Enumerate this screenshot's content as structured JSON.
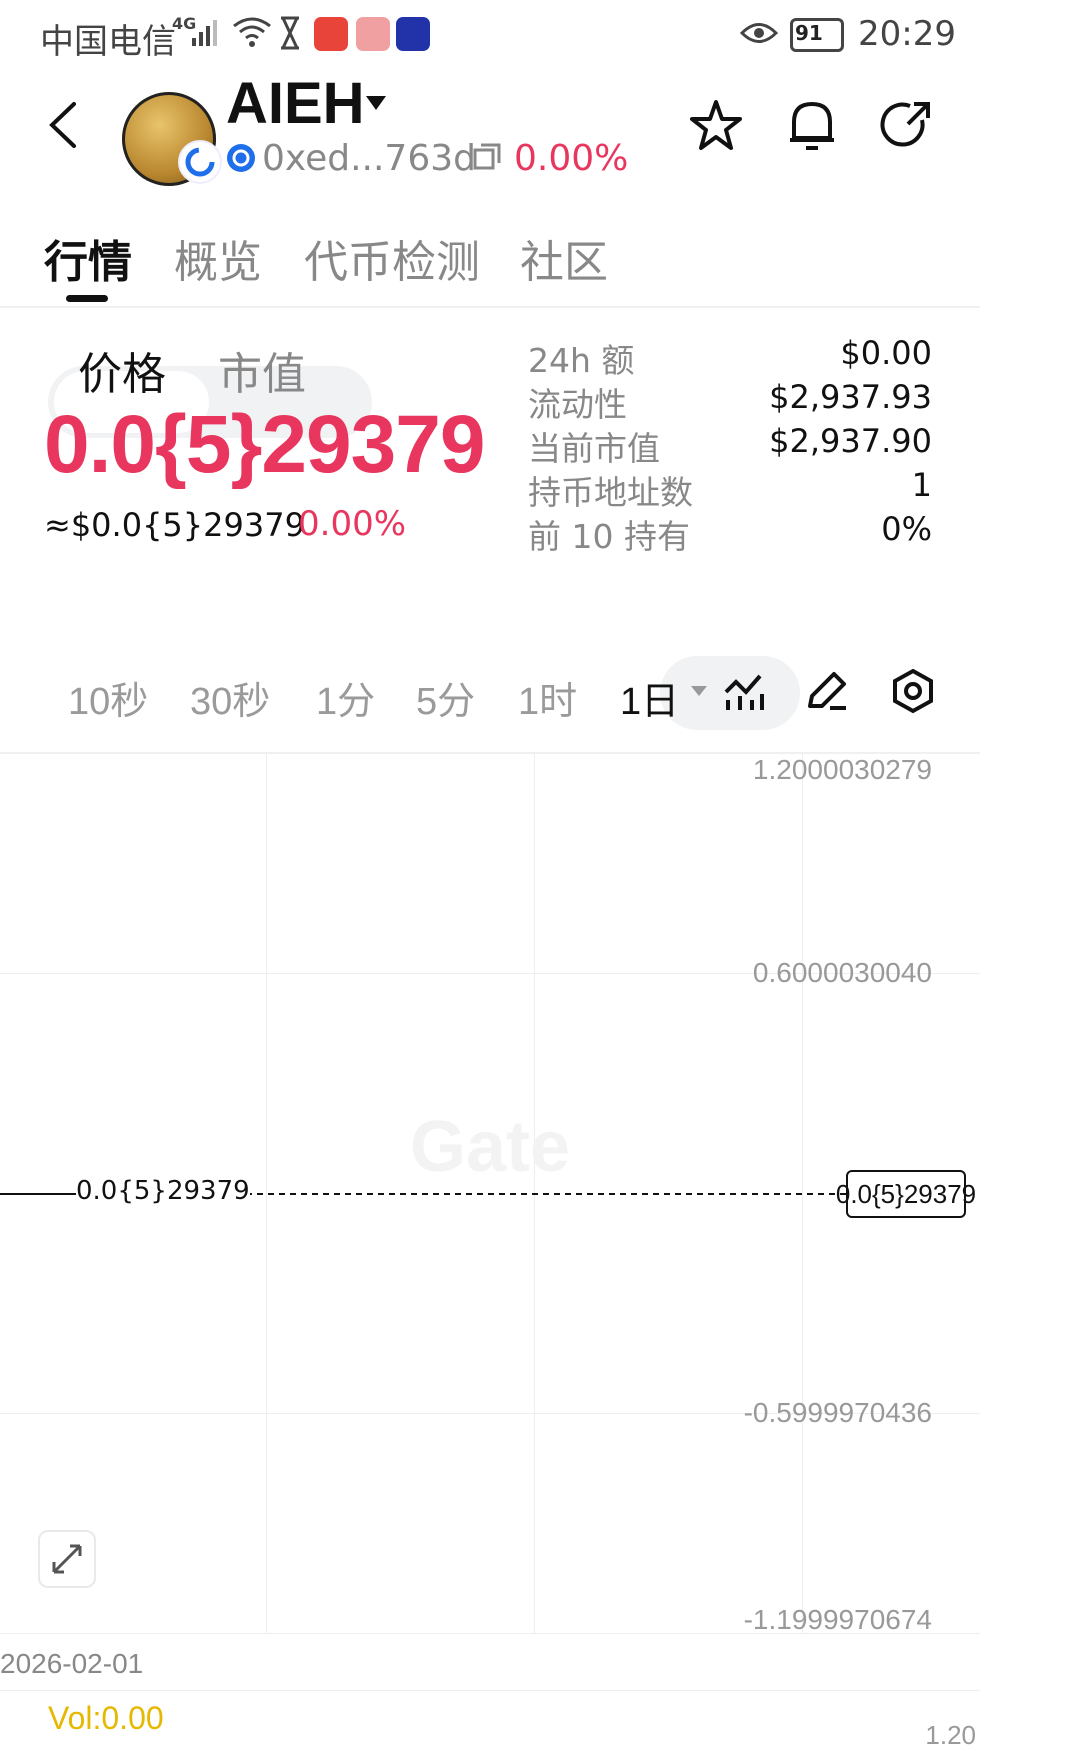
{
  "status_bar": {
    "carrier": "中国电信",
    "network": "4G",
    "battery": "91",
    "time": "20:29"
  },
  "header": {
    "title": "AIEH",
    "address": "0xed...763d",
    "change": "0.00%"
  },
  "tabs": [
    "行情",
    "概览",
    "代币检测",
    "社区"
  ],
  "toggle": {
    "price": "价格",
    "market_cap": "市值"
  },
  "price": {
    "main": "0.0{5}29379",
    "usd": "≈$0.0{5}29379",
    "change": "0.00%"
  },
  "stats": [
    {
      "label": "24h  额",
      "value": "$0.00"
    },
    {
      "label": "流动性",
      "value": "$2,937.93"
    },
    {
      "label": "当前市值",
      "value": "$2,937.90"
    },
    {
      "label": "持币地址数",
      "value": "1"
    },
    {
      "label": "前 10 持有",
      "value": "0%"
    }
  ],
  "intervals": [
    "10秒",
    "30秒",
    "1分",
    "5分",
    "1时"
  ],
  "interval_selected": "1日",
  "chart_data": {
    "type": "line",
    "y_ticks": [
      "1.2000030279",
      "0.6000030040",
      "-0.5999970436",
      "-1.1999970674"
    ],
    "current_price_label": "0.0{5}29379",
    "price_tag": "0.0{5}29379",
    "x_label": "2026-02-01",
    "volume_label": "Vol:0.00",
    "volume_axis_partial": "1.20",
    "watermark": "Gate",
    "series": [
      {
        "values": [
          2.9379e-06,
          2.9379e-06
        ]
      }
    ]
  },
  "colors": {
    "red": "#e8365f",
    "vol_yellow": "#e6b800"
  }
}
